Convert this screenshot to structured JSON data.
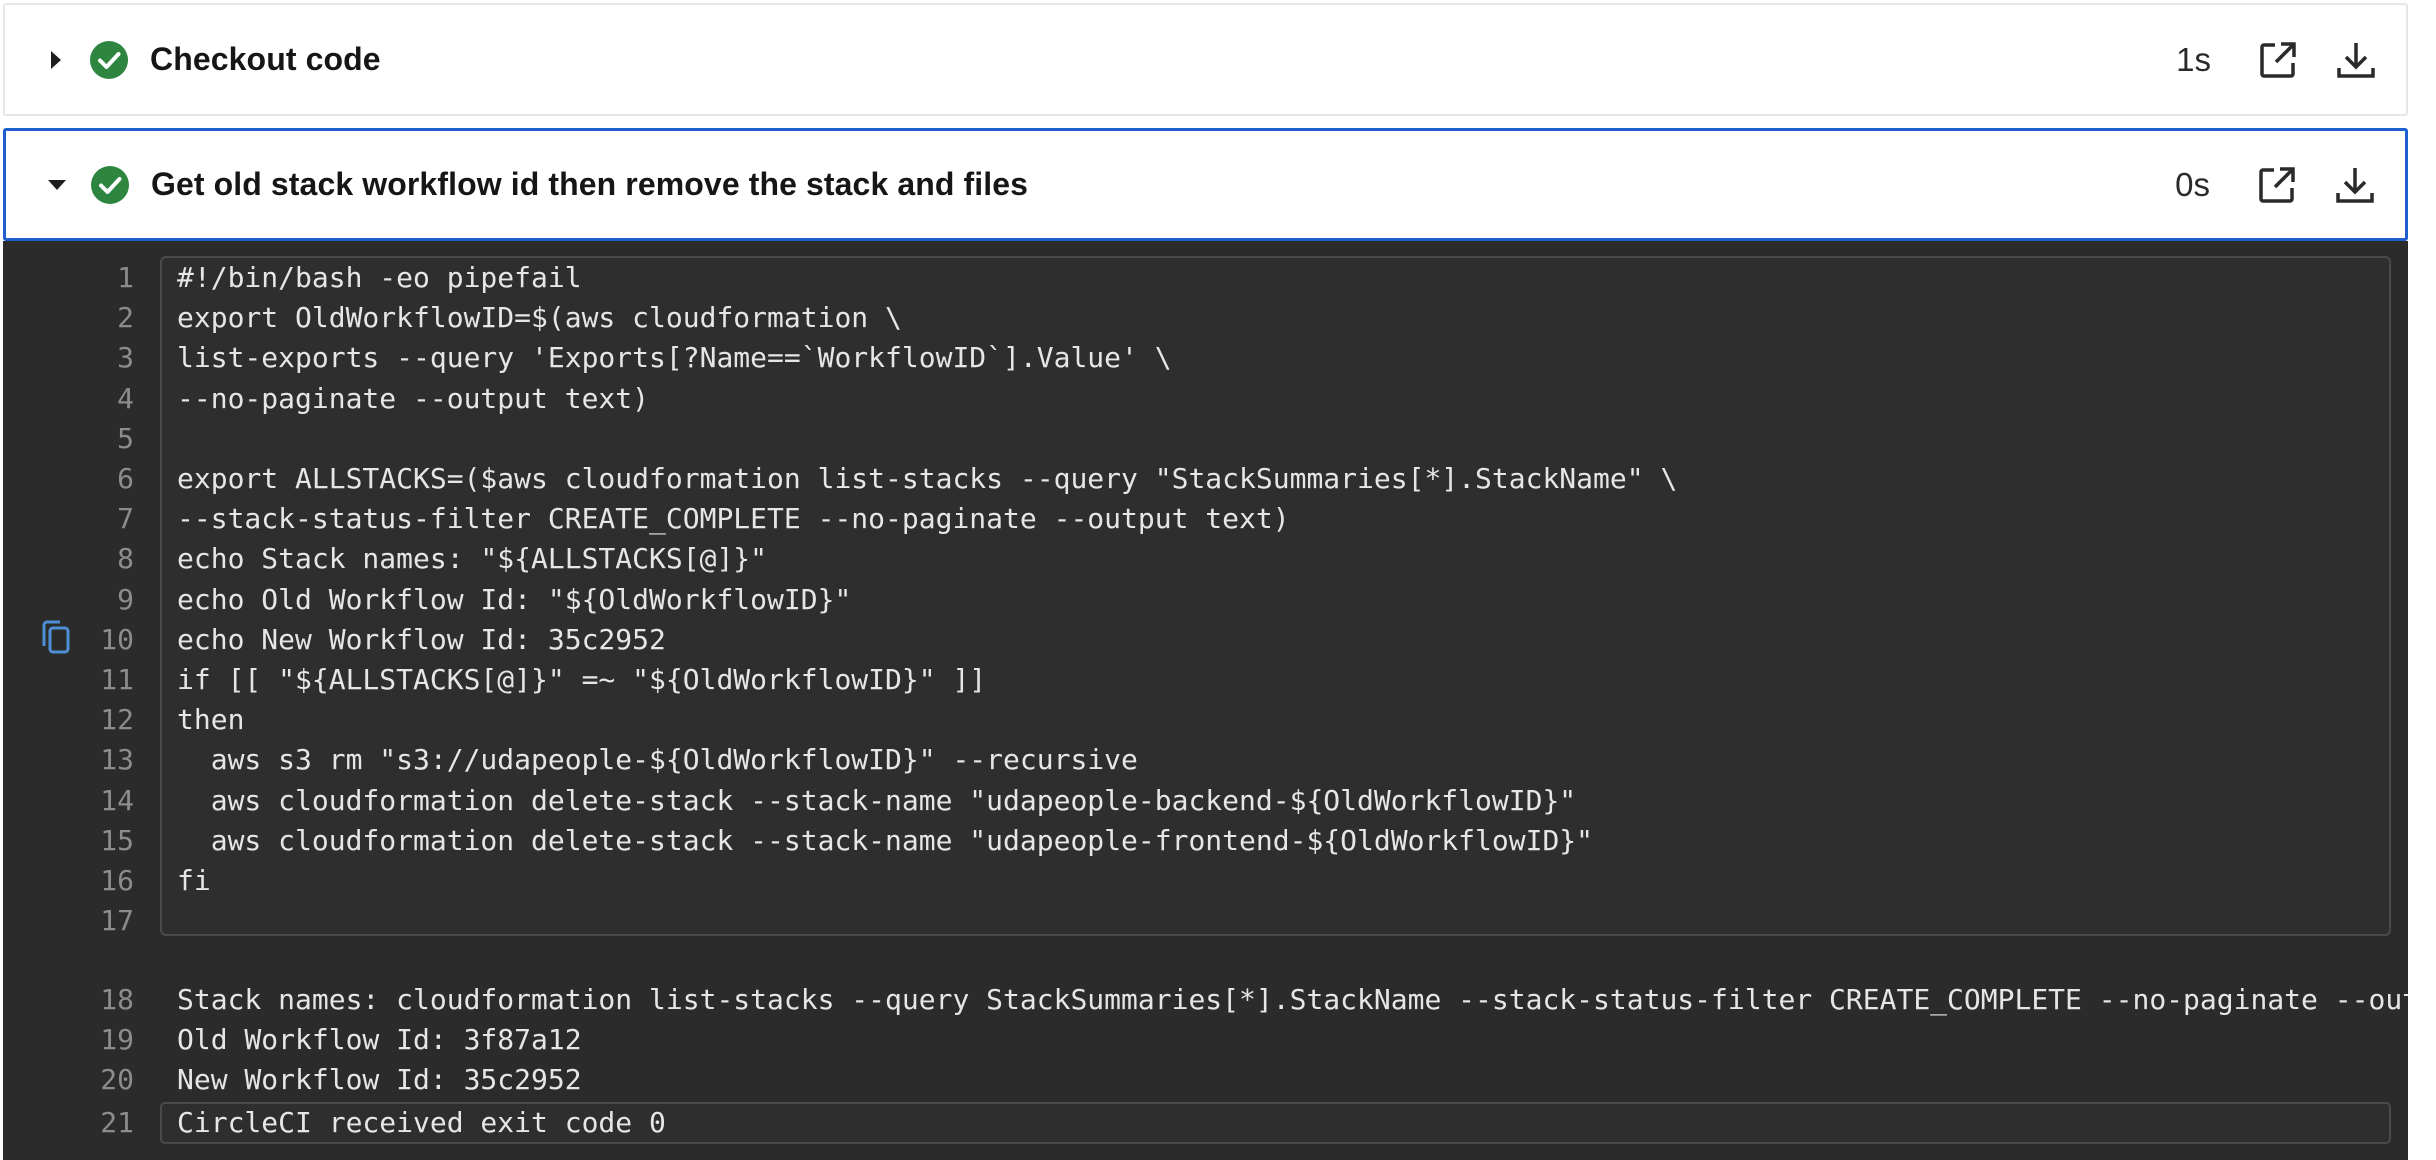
{
  "steps": [
    {
      "title": "Checkout code",
      "duration": "1s",
      "status": "success",
      "expanded": false
    },
    {
      "title": "Get old stack workflow id then remove the stack and files",
      "duration": "0s",
      "status": "success",
      "expanded": true
    }
  ],
  "colors": {
    "success": "#2e8540",
    "selected_border": "#1f5fcc",
    "log_background": "#2b2b2b",
    "copy_icon": "#4f8fd6"
  },
  "icons": {
    "open": "open-in-new-icon",
    "download": "download-icon",
    "copy": "copy-icon",
    "status": "check-circle-icon",
    "caret_collapsed": "caret-right-icon",
    "caret_expanded": "caret-down-icon"
  },
  "log": {
    "command_lines": [
      {
        "n": "1",
        "text": "#!/bin/bash -eo pipefail"
      },
      {
        "n": "2",
        "text": "export OldWorkflowID=$(aws cloudformation \\"
      },
      {
        "n": "3",
        "text": "list-exports --query 'Exports[?Name==`WorkflowID`].Value' \\"
      },
      {
        "n": "4",
        "text": "--no-paginate --output text)"
      },
      {
        "n": "5",
        "text": ""
      },
      {
        "n": "6",
        "text": "export ALLSTACKS=($aws cloudformation list-stacks --query \"StackSummaries[*].StackName\" \\"
      },
      {
        "n": "7",
        "text": "--stack-status-filter CREATE_COMPLETE --no-paginate --output text)"
      },
      {
        "n": "8",
        "text": "echo Stack names: \"${ALLSTACKS[@]}\""
      },
      {
        "n": "9",
        "text": "echo Old Workflow Id: \"${OldWorkflowID}\""
      },
      {
        "n": "10",
        "text": "echo New Workflow Id: 35c2952"
      },
      {
        "n": "11",
        "text": "if [[ \"${ALLSTACKS[@]}\" =~ \"${OldWorkflowID}\" ]]"
      },
      {
        "n": "12",
        "text": "then"
      },
      {
        "n": "13",
        "text": "  aws s3 rm \"s3://udapeople-${OldWorkflowID}\" --recursive"
      },
      {
        "n": "14",
        "text": "  aws cloudformation delete-stack --stack-name \"udapeople-backend-${OldWorkflowID}\""
      },
      {
        "n": "15",
        "text": "  aws cloudformation delete-stack --stack-name \"udapeople-frontend-${OldWorkflowID}\""
      },
      {
        "n": "16",
        "text": "fi"
      },
      {
        "n": "17",
        "text": ""
      }
    ],
    "output_lines": [
      {
        "n": "18",
        "text": "Stack names: cloudformation list-stacks --query StackSummaries[*].StackName --stack-status-filter CREATE_COMPLETE --no-paginate --out"
      },
      {
        "n": "19",
        "text": "Old Workflow Id: 3f87a12"
      },
      {
        "n": "20",
        "text": "New Workflow Id: 35c2952"
      },
      {
        "n": "21",
        "text": "CircleCI received exit code 0"
      }
    ]
  }
}
